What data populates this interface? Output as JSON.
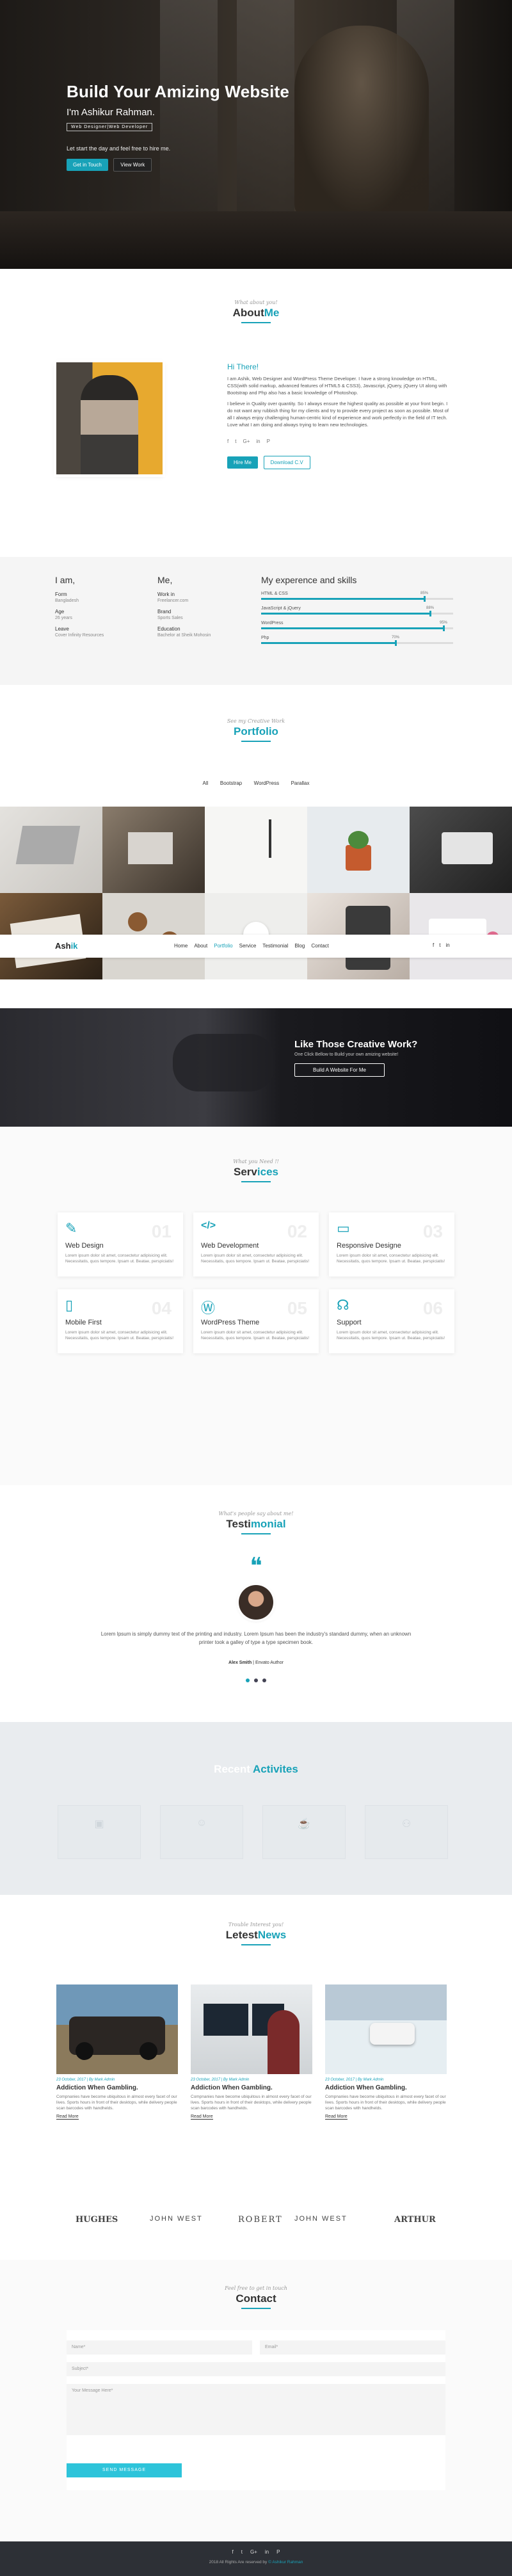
{
  "hero": {
    "title": "Build Your Amizing Website",
    "subtitle": "I'm Ashikur Rahman.",
    "tag": "Web Designer|Web Developer",
    "lead": "Let start the day and feel free to hire me.",
    "btn_primary": "Get in Touch",
    "btn_secondary": "View Work"
  },
  "about": {
    "eyebrow": "What about you!",
    "title_a": "About",
    "title_b": "Me",
    "greeting": "Hi There!",
    "para1": "I am Ashik, Web Designer and WordPress Theme Developer. I have a strong knowledge on HTML, CSS(with solid markup, advanced features of HTML5 & CSS3), Javascript, jQuery, jQuery UI along with Bootstrap and Php also has a basic knowledge of Photoshop.",
    "para2": "I believe in Quality over quantity. So I always ensure the highest quality as possible at your front begin. I do not want any rubbish thing for my clients and try to provide every project as soon as possible. Most of all I always enjoy challenging human-centric kind of experience and work perfectly in the field of IT tech. Love what I am doing and always trying to learn new technologies.",
    "social": [
      "f",
      "t",
      "G+",
      "in",
      "P"
    ],
    "btn_hire": "Hire Me",
    "btn_download": "Download C.V"
  },
  "skills": {
    "col1_title": "I am,",
    "col1": [
      {
        "k": "Form",
        "v": "Bangladesh"
      },
      {
        "k": "Age",
        "v": "26 years"
      },
      {
        "k": "Leave",
        "v": "Cover Infinity Resources"
      }
    ],
    "col2_title": "Me,",
    "col2": [
      {
        "k": "Work in",
        "v": "Freelancer.com"
      },
      {
        "k": "Brand",
        "v": "Sports Sales"
      },
      {
        "k": "Education",
        "v": "Bachelor at Sheik Mohosin"
      }
    ],
    "col3_title": "My experence and skills",
    "bars": [
      {
        "label": "HTML & CSS",
        "pct": 0.85,
        "pct_label": "85%"
      },
      {
        "label": "JavaScript & jQuery",
        "pct": 0.88,
        "pct_label": "88%"
      },
      {
        "label": "WordPress",
        "pct": 0.95,
        "pct_label": "95%"
      },
      {
        "label": "Php",
        "pct": 0.7,
        "pct_label": "70%"
      }
    ]
  },
  "portfolio": {
    "eyebrow": "See my Creative Work",
    "title": "Portfolio",
    "filters": [
      "All",
      "Bootstrap",
      "WordPress",
      "Parallax"
    ]
  },
  "nav": {
    "logo_a": "Ash",
    "logo_b": "ik",
    "items": [
      "Home",
      "About",
      "Portfolio",
      "Service",
      "Testimonial",
      "Blog",
      "Contact"
    ],
    "active": "Portfolio",
    "icons": [
      "f",
      "t",
      "in"
    ]
  },
  "cta": {
    "title": "Like Those Creative Work?",
    "sub": "One Click Bellow to Build your own amizing website!",
    "btn": "Build A Website For Me"
  },
  "services": {
    "eyebrow": "What you Need !!",
    "title_a": "Serv",
    "title_b": "ices",
    "desc": "Lorem ipsum dolor sit amet, consectetur adipisicing elit. Necessitatis, quos tempore. Ipsam ut. Beatae, perspiciatis!",
    "items": [
      {
        "num": "01",
        "icon": "pencil-icon",
        "glyph": "✎",
        "title": "Web Design"
      },
      {
        "num": "02",
        "icon": "code-icon",
        "glyph": "</>",
        "title": "Web Development"
      },
      {
        "num": "03",
        "icon": "laptop-icon",
        "glyph": "▭",
        "title": "Responsive Designe"
      },
      {
        "num": "04",
        "icon": "tablet-icon",
        "glyph": "▯",
        "title": "Mobile First"
      },
      {
        "num": "05",
        "icon": "wordpress-icon",
        "glyph": "Ⓦ",
        "title": "WordPress Theme"
      },
      {
        "num": "06",
        "icon": "headset-icon",
        "glyph": "☊",
        "title": "Support"
      }
    ]
  },
  "testimonial": {
    "eyebrow": "What's people say about me!",
    "title_a": "Testi",
    "title_b": "monial",
    "text": "Lorem Ipsum is simply dummy text of the printing and industry. Lorem Ipsum has been the industry's standard dummy, when an unknown printer took a galley of type a type specimen book.",
    "name": "Alex Smith",
    "role": "Envato Author"
  },
  "activities": {
    "title_a": "Recent",
    "title_b": " Activites"
  },
  "news": {
    "eyebrow": "Trouble Interest you!",
    "title_a": "Letest",
    "title_b": "News",
    "cards": [
      {
        "meta": "23 October, 2017 | By Mark Admin",
        "title": "Addiction When Gambling.",
        "text": "Compnanies have become ubiquitous in almost every facet of our lives. Sports hours in front of their desktops, while delivery people scan barcodes with handhelds.",
        "more": "Read More"
      },
      {
        "meta": "23 October, 2017 | By Mark Admin",
        "title": "Addiction When Gambling.",
        "text": "Compnanies have become ubiquitous in almost every facet of our lives. Sports hours in front of their desktops, while delivery people scan barcodes with handhelds.",
        "more": "Read More"
      },
      {
        "meta": "23 October, 2017 | By Mark Admin",
        "title": "Addiction When Gambling.",
        "text": "Compnanies have become ubiquitous in almost every facet of our lives. Sports hours in front of their desktops, while delivery people scan barcodes with handhelds.",
        "more": "Read More"
      }
    ]
  },
  "brands": [
    "HUGHES",
    "JOHN WEST",
    "ROBERT",
    "JOHN WEST",
    "ARTHUR"
  ],
  "contact": {
    "eyebrow": "Feel free to get in touch",
    "title": "Contact",
    "name_ph": "Name*",
    "email_ph": "Email*",
    "subject_ph": "Subject*",
    "message_ph": "Your Message Here*",
    "send": "SEND MESSAGE"
  },
  "footer": {
    "icons": [
      "f",
      "t",
      "G+",
      "in",
      "P"
    ],
    "copy_a": "2018 All Rights Are reserved by ",
    "copy_b": "© Ashikur Rahman"
  }
}
